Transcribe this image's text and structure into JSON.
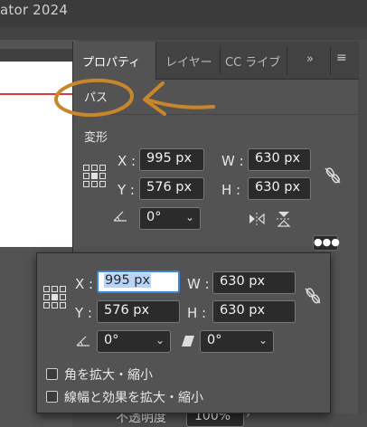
{
  "window": {
    "title_fragment": "ator 2024"
  },
  "tabs": [
    {
      "label": "プロパティ"
    },
    {
      "label": "レイヤー"
    },
    {
      "label": "CC ライブ"
    }
  ],
  "tab_more": "»",
  "tab_menu": "≡",
  "section": {
    "path_label": "パス",
    "transform_label": "変形"
  },
  "transform": {
    "x_label": "X :",
    "x_value": "995 px",
    "y_label": "Y :",
    "y_value": "576 px",
    "w_label": "W :",
    "w_value": "630 px",
    "h_label": "H :",
    "h_value": "630 px",
    "angle_value": "0°"
  },
  "popup": {
    "x_label": "X :",
    "x_value": "995 px",
    "y_label": "Y :",
    "y_value": "576 px",
    "w_label": "W :",
    "w_value": "630 px",
    "h_label": "H :",
    "h_value": "630 px",
    "angle_value": "0°",
    "shear_value": "0°",
    "checkbox_scale_corners": "角を拡大・縮小",
    "checkbox_scale_strokes": "線幅と効果を拡大・縮小"
  },
  "appearance": {
    "opacity_label": "不透明度",
    "opacity_value": "100%"
  },
  "annotation_color": "#c8862a",
  "icons": [
    "link-constrain-icon",
    "flip-horizontal-icon",
    "flip-vertical-icon",
    "more-options-icon",
    "angle-icon",
    "shear-icon"
  ]
}
